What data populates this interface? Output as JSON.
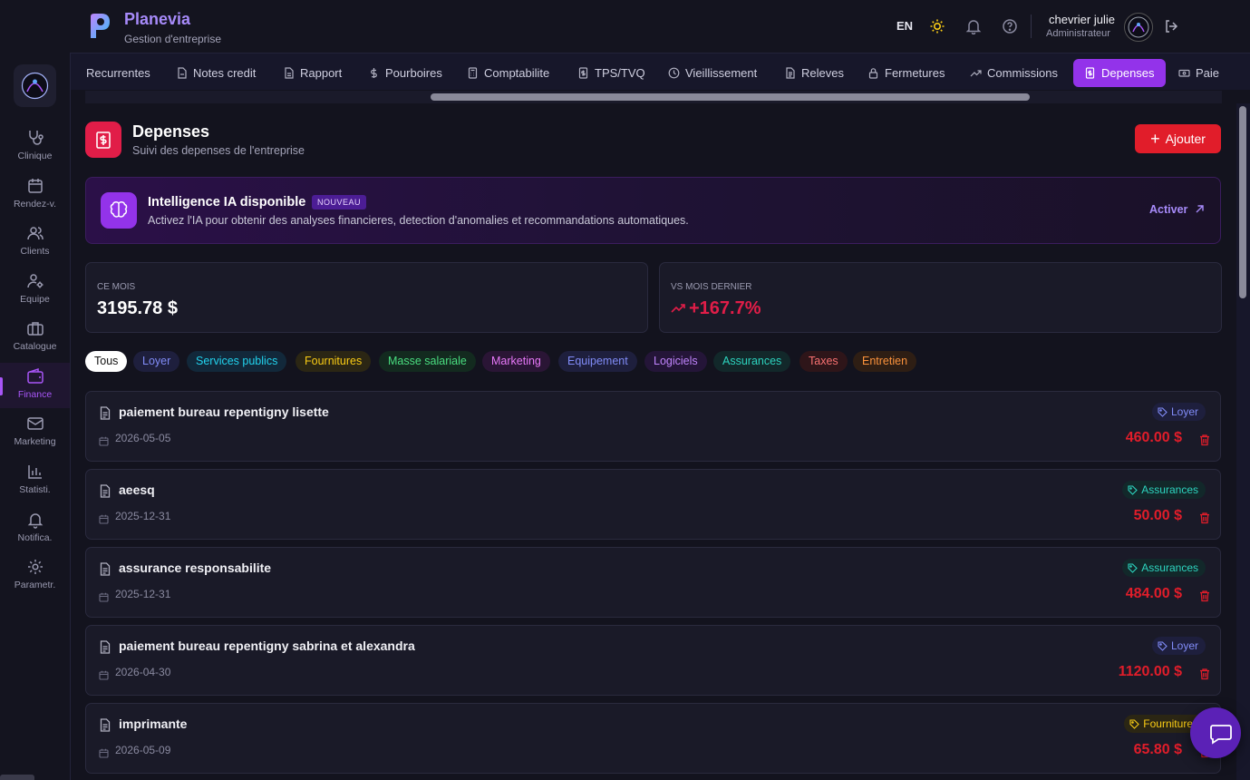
{
  "app": {
    "name": "Planevia",
    "subtitle": "Gestion d'entreprise",
    "language": "EN"
  },
  "user": {
    "name": "chevrier julie",
    "role": "Administrateur"
  },
  "sidebar": {
    "items": [
      {
        "label": "Clinique",
        "icon": "stethoscope-icon"
      },
      {
        "label": "Rendez-v.",
        "icon": "calendar-icon"
      },
      {
        "label": "Clients",
        "icon": "users-icon"
      },
      {
        "label": "Equipe",
        "icon": "user-cog-icon"
      },
      {
        "label": "Catalogue",
        "icon": "briefcase-icon"
      },
      {
        "label": "Finance",
        "icon": "wallet-icon",
        "active": true
      },
      {
        "label": "Marketing",
        "icon": "mail-icon"
      },
      {
        "label": "Statisti.",
        "icon": "bar-chart-icon"
      },
      {
        "label": "Notifica.",
        "icon": "bell-icon"
      },
      {
        "label": "Parametr.",
        "icon": "gear-icon"
      }
    ]
  },
  "tabs": [
    {
      "label": "Recurrentes",
      "icon": ""
    },
    {
      "label": "Notes credit",
      "icon": "file-minus-icon"
    },
    {
      "label": "Rapport",
      "icon": "file-icon"
    },
    {
      "label": "Pourboires",
      "icon": "dollar-icon"
    },
    {
      "label": "Comptabilite",
      "icon": "calculator-icon"
    },
    {
      "label": "TPS/TVQ",
      "icon": "receipt-icon"
    },
    {
      "label": "Vieillissement",
      "icon": "clock-icon"
    },
    {
      "label": "Releves",
      "icon": "file-text-icon"
    },
    {
      "label": "Fermetures",
      "icon": "lock-icon"
    },
    {
      "label": "Commissions",
      "icon": "trend-up-icon"
    },
    {
      "label": "Depenses",
      "icon": "receipt-icon",
      "active": true
    },
    {
      "label": "Paie",
      "icon": "banknote-icon"
    }
  ],
  "page": {
    "title": "Depenses",
    "subtitle": "Suivi des depenses de l'entreprise",
    "add_label": "Ajouter"
  },
  "ai_banner": {
    "title": "Intelligence IA disponible",
    "badge": "NOUVEAU",
    "description": "Activez l'IA pour obtenir des analyses financieres, detection d'anomalies et recommandations automatiques.",
    "action": "Activer"
  },
  "stats": {
    "this_month_label": "CE MOIS",
    "this_month_value": "3195.78 $",
    "vs_last_label": "VS MOIS DERNIER",
    "vs_last_value": "+167.7%"
  },
  "filters": [
    {
      "label": "Tous",
      "fg": "#111111",
      "bg": "#ffffff",
      "active": true
    },
    {
      "label": "Loyer",
      "fg": "#818cf8",
      "bg": "#1e1f3d"
    },
    {
      "label": "Services publics",
      "fg": "#22d3ee",
      "bg": "#12283a"
    },
    {
      "label": "Fournitures",
      "fg": "#facc15",
      "bg": "#2b2614"
    },
    {
      "label": "Masse salariale",
      "fg": "#4ade80",
      "bg": "#132a1f"
    },
    {
      "label": "Marketing",
      "fg": "#e879f9",
      "bg": "#2a1535"
    },
    {
      "label": "Equipement",
      "fg": "#818cf8",
      "bg": "#1e1f3d"
    },
    {
      "label": "Logiciels",
      "fg": "#c084fc",
      "bg": "#241538"
    },
    {
      "label": "Assurances",
      "fg": "#2dd4bf",
      "bg": "#12282a"
    },
    {
      "label": "Taxes",
      "fg": "#f87171",
      "bg": "#2e1519"
    },
    {
      "label": "Entretien",
      "fg": "#fb923c",
      "bg": "#2e1e14"
    }
  ],
  "expenses": [
    {
      "name": "paiement bureau repentigny lisette",
      "date": "2026-05-05",
      "category": "Loyer",
      "fg": "#818cf8",
      "bg": "#1e1f3d",
      "amount": "460.00 $"
    },
    {
      "name": "aeesq",
      "date": "2025-12-31",
      "category": "Assurances",
      "fg": "#2dd4bf",
      "bg": "#12282a",
      "amount": "50.00 $"
    },
    {
      "name": "assurance responsabilite",
      "date": "2025-12-31",
      "category": "Assurances",
      "fg": "#2dd4bf",
      "bg": "#12282a",
      "amount": "484.00 $"
    },
    {
      "name": "paiement bureau repentigny sabrina et alexandra",
      "date": "2026-04-30",
      "category": "Loyer",
      "fg": "#818cf8",
      "bg": "#1e1f3d",
      "amount": "1120.00 $"
    },
    {
      "name": "imprimante",
      "date": "2026-05-09",
      "category": "Fournitures",
      "fg": "#facc15",
      "bg": "#2b2614",
      "amount": "65.80 $"
    }
  ],
  "colors": {
    "accent": "#9333ea",
    "danger": "#e11d2a",
    "background": "#13131e"
  }
}
